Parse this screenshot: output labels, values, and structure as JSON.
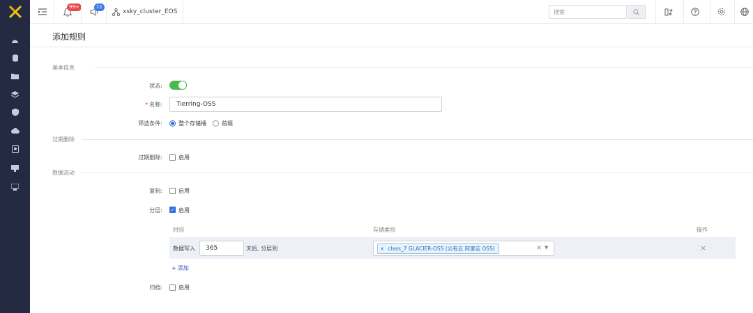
{
  "topbar": {
    "notifications_badge": "99+",
    "announcements_badge": "11",
    "cluster_name": "xsky_cluster_EOS",
    "search_placeholder": "搜索"
  },
  "page": {
    "title": "添加规则"
  },
  "basic": {
    "section_title": "基本信息",
    "status_label": "状态:",
    "status_enabled": true,
    "name_label": "名称:",
    "name_value": "Tierring-OSS",
    "filter_label": "筛选条件:",
    "filter_options": [
      "整个存储桶",
      "前缀"
    ],
    "filter_selected": "整个存储桶"
  },
  "expiration": {
    "section_title": "过期删除",
    "label": "过期删除:",
    "enable_text": "启用",
    "checked": false
  },
  "dataflow": {
    "section_title": "数据流动",
    "replication": {
      "label": "复制:",
      "enable_text": "启用",
      "checked": false
    },
    "tiering": {
      "label": "分层:",
      "enable_text": "启用",
      "checked": true,
      "columns": [
        "时间",
        "存储类别",
        "操作"
      ],
      "rows": [
        {
          "prefix": "数据写入",
          "days": "365",
          "suffix": "天后, 分层到",
          "storage_class": "class_7 GLACIER-OSS (公有云 阿里云 OSS)"
        }
      ],
      "add_text": "添加"
    },
    "archive": {
      "label": "归档:",
      "enable_text": "启用",
      "checked": false
    }
  },
  "colors": {
    "sidebar_bg": "#252a43",
    "accent": "#2f6fe0",
    "switch_on": "#4cb94f",
    "badge_red": "#e84a4a",
    "badge_blue": "#3a7be8"
  }
}
